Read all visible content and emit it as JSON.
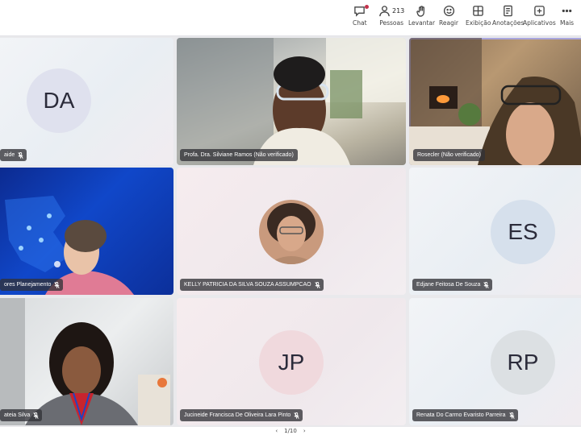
{
  "toolbar": {
    "chat_label": "Chat",
    "people_label": "Pessoas",
    "people_count": "213",
    "raise_label": "Levantar",
    "react_label": "Reagir",
    "view_label": "Exibição",
    "notes_label": "Anotações",
    "apps_label": "Aplicativos",
    "more_label": "Mais"
  },
  "tiles": [
    {
      "initials": "DA",
      "name": "aide"
    },
    {
      "name": "Profa. Dra. Silviane Ramos (Não verificado)"
    },
    {
      "name": "Rosecler (Não verificado)"
    },
    {
      "name": "ores Planejamento"
    },
    {
      "name": "KELLY PATRICIA DA SILVA SOUZA ASSUMPCAO"
    },
    {
      "initials": "ES",
      "name": "Edjane Feitosa De Souza"
    },
    {
      "name": "ateia Silva"
    },
    {
      "initials": "JP",
      "name": "Jucineide Francisca De Oliveira Lara Pinto"
    },
    {
      "initials": "RP",
      "name": "Renata Do Carmo Evaristo Parreira"
    }
  ],
  "pagination": {
    "text": "1/10"
  },
  "colors": {
    "accent": "#a9a6dd",
    "notification": "#c4314b",
    "avatar_blue": "#d6e0ec",
    "avatar_pink": "#f0d9dd"
  }
}
